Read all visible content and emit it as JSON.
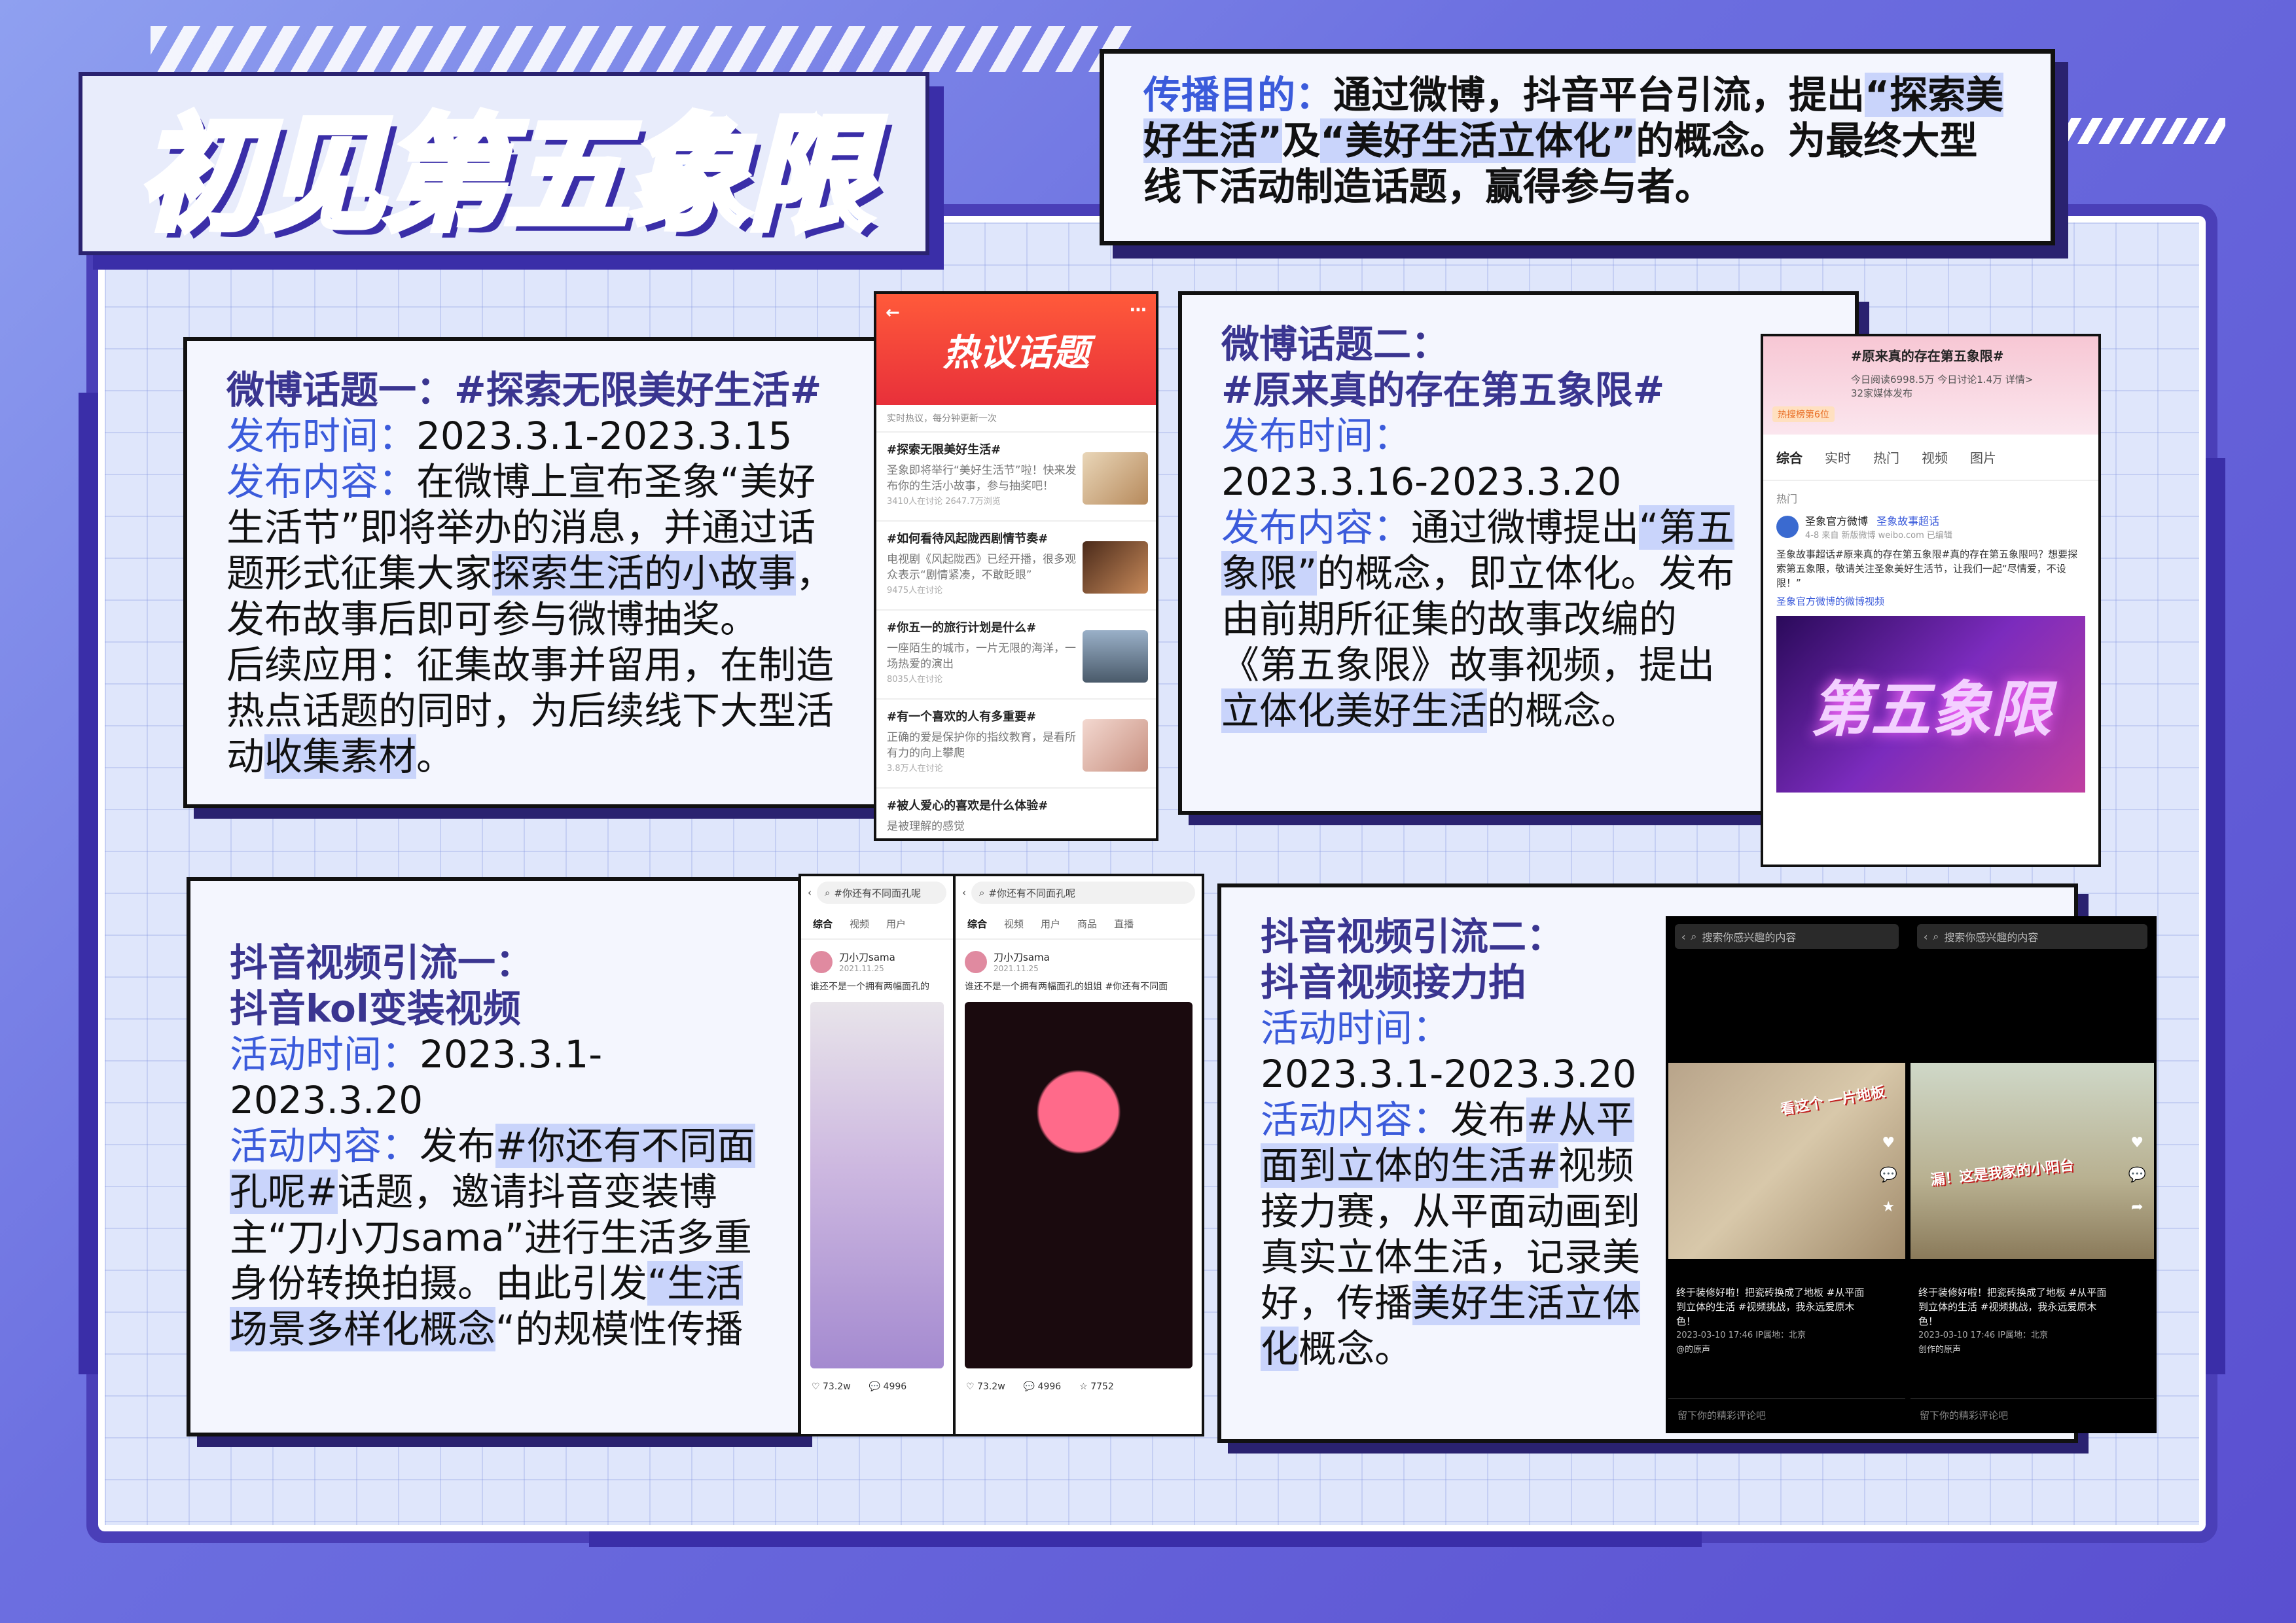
{
  "title": "初见第五象限",
  "purpose": {
    "label": "传播目的：",
    "text1": "通过微博，抖音平台引流，提出",
    "quote1": "“探索美好生活”",
    "text2": "及",
    "quote2": "“美好生活立体化”",
    "text3": "的概念。为最终大型线下活动制造话题，赢得参与者。"
  },
  "card1": {
    "heading": "微博话题一：#探索无限美好生活#",
    "time_label": "发布时间：",
    "time": "2023.3.1-2023.3.15",
    "content_label": "发布内容：",
    "content_a": "在微博上宣布圣象“美好生活节”即将举办的消息，并通过话题形式征集大家",
    "content_hl": "探索生活的小故事",
    "content_b": "，发布故事后即可参与微博抽奖。",
    "after": "后续应用：征集故事并留用，在制造热点话题的同时，为后续线下大型活动",
    "after_hl": "收集素材",
    "after_end": "。"
  },
  "card2": {
    "heading1": "微博话题二：",
    "heading2": "#原来真的存在第五象限#",
    "time_label": "发布时间：",
    "time": "2023.3.16-2023.3.20",
    "content_label": "发布内容：",
    "content_a": "通过微博提出",
    "content_hl1": "“第五象限”",
    "content_b": "的概念，即立体化。发布由前期所征集的故事改编的《第五象限》故事视频，提出",
    "content_hl2": "立体化美好生活",
    "content_c": "的概念。"
  },
  "card3": {
    "heading1": "抖音视频引流一：",
    "heading2": "抖音kol变装视频",
    "time_label": "活动时间：",
    "time": "2023.3.1-2023.3.20",
    "content_label": "活动内容：",
    "content_a": "发布",
    "content_hl1": "#你还有不同面孔呢#",
    "content_b": "话题，邀请抖音变装博主“刀小刀sama”进行生活多重身份转换拍摄。由此引发",
    "content_hl2": "“生活场景多样化概念",
    "content_c": "“的规模性传播"
  },
  "card4": {
    "heading1": "抖音视频引流二：",
    "heading2": "抖音视频接力拍",
    "time_label": "活动时间：",
    "time": "2023.3.1-2023.3.20",
    "content_label": "活动内容：",
    "content_a": "发布",
    "content_hl1": "#从平面到立体的生活#",
    "content_b": "视频接力赛，从平面动画到真实立体生活，记录美好，传播",
    "content_hl2": "美好生活立体化",
    "content_c": "概念。"
  },
  "weibo_hot": {
    "header": "热议话题",
    "sub": "实时热议，每分钟更新一次",
    "items": [
      {
        "title": "#探索无限美好生活#",
        "desc": "圣象即将举行“美好生活节”啦！快来发布你的生活小故事，参与抽奖吧！",
        "meta": "3410人在讨论 2647.7万浏览"
      },
      {
        "title": "#如何看待风起陇西剧情节奏#",
        "desc": "电视剧《风起陇西》已经开播，很多观众表示“剧情紧凑，不敢眨眼”",
        "meta": "9475人在讨论"
      },
      {
        "title": "#你五一的旅行计划是什么#",
        "desc": "一座陌生的城市，一片无限的海洋，一场热爱的演出",
        "meta": "8035人在讨论"
      },
      {
        "title": "#有一个喜欢的人有多重要#",
        "desc": "正确的爱是保护你的指纹教育，是看所有力的向上攀爬",
        "meta": "3.8万人在讨论"
      },
      {
        "title": "#被人爱心的喜欢是什么体验#",
        "desc": "是被理解的感觉",
        "meta": ""
      }
    ]
  },
  "weibo_topic2": {
    "topic": "#原来真的存在第五象限#",
    "stats": "今日阅读6998.5万 今日讨论1.4万 详情>",
    "media": "32家媒体发布",
    "rank": "热搜榜第6位",
    "tabs": [
      "综合",
      "实时",
      "热门",
      "视频",
      "图片"
    ],
    "section": "热门",
    "account": "圣象官方微博",
    "super": "圣象故事超话",
    "date": "4-8 来自 新版微博 weibo.com 已编辑",
    "post": "圣象故事超话#原来真的存在第五象限#真的存在第五象限吗？想要探索第五象限，敬请关注圣象美好生活节，让我们一起“尽情爱，不设限！”",
    "video_link": "圣象官方微博的微博视频",
    "neon": "第五象限"
  },
  "douyin1": {
    "search": "#你还有不同面孔呢",
    "tabs": [
      "综合",
      "视频",
      "用户"
    ],
    "user": "刀小刀sama",
    "date": "2021.11.25",
    "desc": "谁还不是一个拥有两幅面孔的",
    "likes": "73.2w",
    "comments": "4996"
  },
  "douyin2": {
    "search": "#你还有不同面孔呢",
    "tabs": [
      "综合",
      "视频",
      "用户",
      "商品",
      "直播"
    ],
    "user": "刀小刀sama",
    "date": "2021.11.25",
    "desc": "谁还不是一个拥有两幅面孔的姐姐 #你还有不同面",
    "likes": "73.2w",
    "comments": "4996",
    "stars": "7752"
  },
  "douyin3": {
    "search": "搜索你感兴趣的内容",
    "sticker": "看这个 一片地板",
    "text": "终于装修好啦！把瓷砖换成了地板 #从平面到立体的生活 #视频挑战，我永远爱原木色！",
    "time": "2023-03-10 17:46 IP属地：北京",
    "music": "@的原声",
    "comment": "留下你的精彩评论吧"
  },
  "douyin4": {
    "search": "搜索你感兴趣的内容",
    "sticker": "漏！这是我家的小阳台",
    "text": "终于装修好啦！把瓷砖换成了地板 #从平面到立体的生活 #视频挑战，我永远爱原木色！",
    "time": "2023-03-10 17:46 IP属地：北京",
    "music": "创作的原声",
    "comment": "留下你的精彩评论吧"
  }
}
